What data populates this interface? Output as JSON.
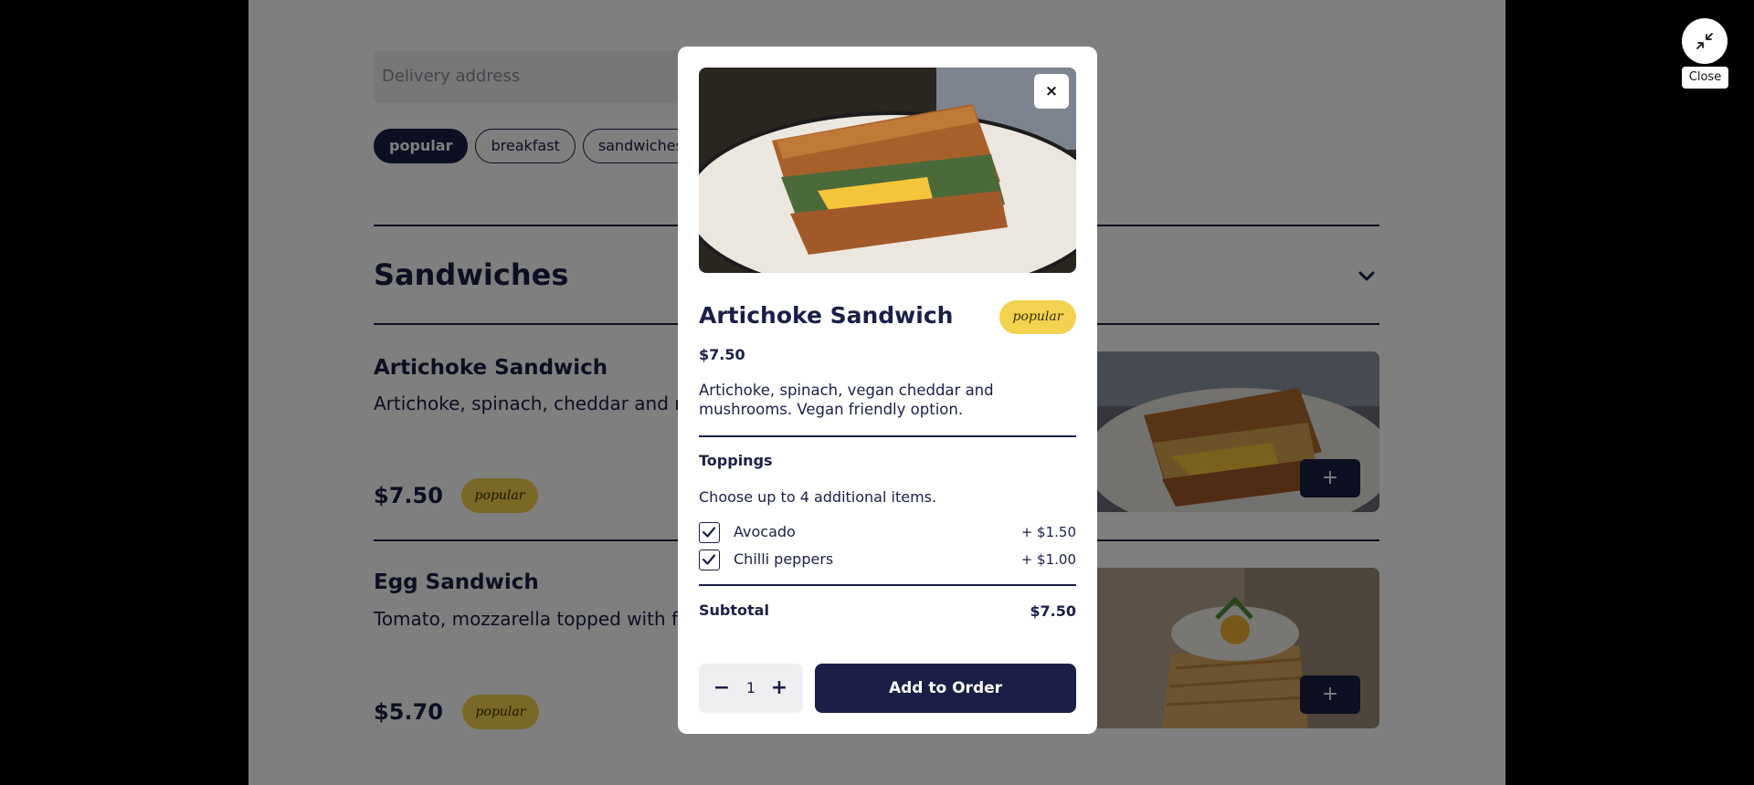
{
  "background": {
    "search": {
      "placeholder": "Delivery address"
    },
    "chips": [
      {
        "label": "popular",
        "active": true
      },
      {
        "label": "breakfast",
        "active": false
      },
      {
        "label": "sandwiches",
        "active": false
      }
    ],
    "section": {
      "title": "Sandwiches",
      "icon": "chevron-down-icon"
    },
    "items": [
      {
        "name": "Artichoke Sandwich",
        "description": "Artichoke, spinach, cheddar and m",
        "price": "$7.50",
        "badge": "popular",
        "add_label": "+"
      },
      {
        "name": "Egg Sandwich",
        "description": "Tomato, mozzarella topped with fri",
        "price": "$5.70",
        "badge": "popular",
        "add_label": "+"
      }
    ]
  },
  "fullscreen_close": {
    "icon": "minimize-icon",
    "label": "Close"
  },
  "modal": {
    "close_icon": "close-icon",
    "close_label": "×",
    "title": "Artichoke Sandwich",
    "badge": "popular",
    "price": "$7.50",
    "description": "Artichoke, spinach, vegan cheddar and mushrooms. Vegan friendly option.",
    "toppings": {
      "heading": "Toppings",
      "hint": "Choose up to 4 additional items.",
      "options": [
        {
          "label": "Avocado",
          "price": "+ $1.50",
          "checked": true
        },
        {
          "label": "Chilli peppers",
          "price": "+ $1.00",
          "checked": true
        }
      ]
    },
    "subtotal": {
      "label": "Subtotal",
      "value": "$7.50"
    },
    "quantity": {
      "minus": "−",
      "value": "1",
      "plus": "+"
    },
    "add_button": "Add to Order"
  },
  "colors": {
    "navy": "#1b1f47",
    "badge_yellow": "#f2d24f",
    "overlay": "rgba(0,0,0,0.5)"
  }
}
